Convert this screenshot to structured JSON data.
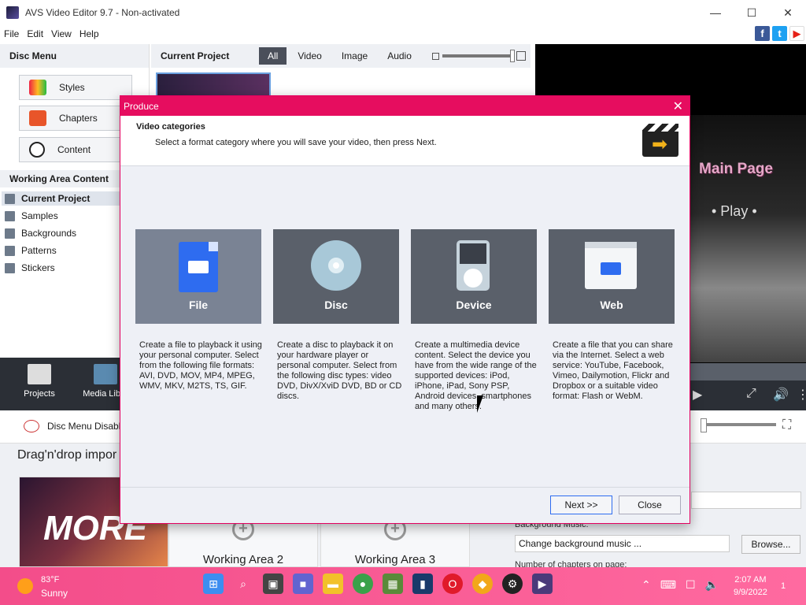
{
  "window": {
    "title": "AVS Video Editor 9.7 - Non-activated",
    "minimize": "—",
    "maximize": "☐",
    "close": "✕"
  },
  "menu": [
    "File",
    "Edit",
    "View",
    "Help"
  ],
  "social": {
    "facebook": "f",
    "twitter": "t",
    "youtube": "▶"
  },
  "disc_menu": {
    "header": "Disc Menu",
    "buttons": [
      "Styles",
      "Chapters",
      "Content"
    ]
  },
  "working_area": {
    "header": "Working Area Content",
    "items": [
      "Current Project",
      "Samples",
      "Backgrounds",
      "Patterns",
      "Stickers"
    ]
  },
  "current_project": {
    "title": "Current Project",
    "filters": [
      "All",
      "Video",
      "Image",
      "Audio"
    ]
  },
  "preview": {
    "main_page": "Main Page",
    "play": "• Play •"
  },
  "toolbar": {
    "projects": "Projects",
    "media_library": "Media Libra"
  },
  "disc_menu_disabled": "Disc Menu Disabled",
  "drag_drop": "Drag'n'drop impor",
  "work_areas": {
    "thumb_text": "MORE",
    "area2": "Working Area 2",
    "area3": "Working Area 3"
  },
  "settings": {
    "bg_music_label": "Background Music:",
    "bg_music_value": "Change background music ...",
    "browse": "Browse...",
    "chapters_label": "Number of chapters on page:"
  },
  "dialog": {
    "title": "Produce",
    "close": "✕",
    "heading": "Video categories",
    "subheading": "Select a format category where you will save your video, then press Next.",
    "categories": [
      {
        "label": "File",
        "desc": "Create a file to playback it using your personal computer. Select from the following file formats: AVI, DVD, MOV, MP4, MPEG, WMV, MKV, M2TS, TS, GIF."
      },
      {
        "label": "Disc",
        "desc": "Create a disc to playback it on your hardware player or personal computer. Select from the following disc types: video DVD, DivX/XviD DVD, BD or CD discs."
      },
      {
        "label": "Device",
        "desc": "Create a multimedia device content. Select the device you have from the wide range of the supported devices: iPod, iPhone, iPad, Sony PSP, Android devices, smartphones and many others."
      },
      {
        "label": "Web",
        "desc": "Create a file that you can share via the Internet. Select a web service: YouTube, Facebook, Vimeo, Dailymotion, Flickr and Dropbox or a suitable video format: Flash or WebM."
      }
    ],
    "next": "Next >>",
    "close_btn": "Close"
  },
  "taskbar": {
    "temp": "83°F",
    "condition": "Sunny",
    "time": "2:07 AM",
    "date": "9/9/2022",
    "notifications": "1"
  }
}
